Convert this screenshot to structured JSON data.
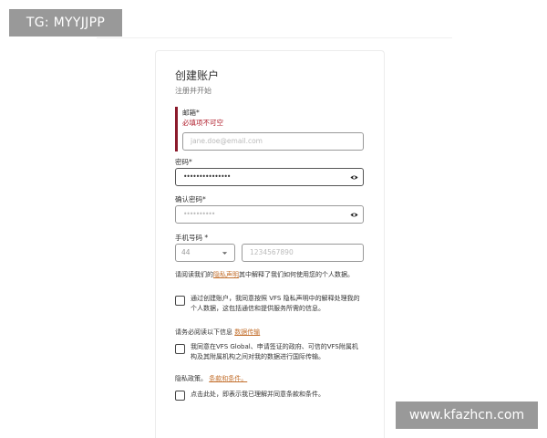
{
  "badge": "TG: MYYJJPP",
  "watermark": "www.kfazhcn.com",
  "form": {
    "title": "创建账户",
    "subtitle": "注册并开始",
    "email": {
      "label": "邮箱*",
      "error": "必填项不可空",
      "placeholder": "jane.doe@email.com"
    },
    "password": {
      "label": "密码*",
      "value": "•••••••••••••••"
    },
    "confirm_password": {
      "label": "确认密码*",
      "value": "••••••••••"
    },
    "phone": {
      "label": "手机号码 *",
      "country_code": "44",
      "placeholder": "1234567890"
    },
    "privacy_notice": {
      "before": "请阅读我们的",
      "link": "隐私声明",
      "after": "其中解释了我们如何使用您的个人数据。"
    },
    "consent_1": {
      "text": "通过创建账户，我同意按照 VFS 隐私声明中的解释处理我的个人数据，这包括通信和提供服务所需的信息。"
    },
    "transfer_notice": {
      "before": "请务必阅读以下信息",
      "link": "数据传输"
    },
    "consent_2": {
      "text": "我同意在VFS Global、申请签证的政府、可信的VFS附属机构及其附属机构之间对我的数据进行国际传输。"
    },
    "policy_notice": {
      "before": "隐私政策。",
      "link": "条款和条件。"
    },
    "consent_3": {
      "text": "点击此处，即表示我已理解并同意条款和条件。"
    }
  }
}
